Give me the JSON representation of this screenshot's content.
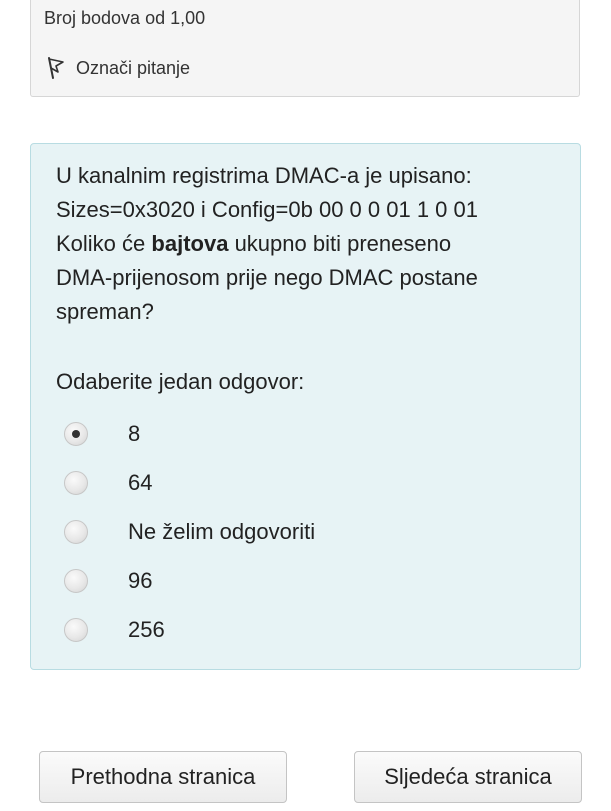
{
  "info": {
    "points_text": "Broj bodova od 1,00",
    "flag_label": "Označi pitanje",
    "flag_icon": "flag-icon"
  },
  "question": {
    "line1": "U kanalnim registrima DMAC-a je upisano:",
    "line2": "Sizes=0x3020 i Config=0b 00 0 0 01 1 0 01",
    "line3_before": "Koliko će",
    "line3_bold": "bajtova",
    "line3_after": "ukupno biti preneseno",
    "line4": "DMA-prijenosom prije nego DMAC postane",
    "line5": "spreman?",
    "prompt": "Odaberite jedan odgovor:",
    "options": [
      {
        "label": "8",
        "selected": true
      },
      {
        "label": "64",
        "selected": false
      },
      {
        "label": "Ne želim odgovoriti",
        "selected": false
      },
      {
        "label": "96",
        "selected": false
      },
      {
        "label": "256",
        "selected": false
      }
    ],
    "colors": {
      "panel_background": "#e7f3f5",
      "panel_border": "#b8dce2"
    }
  },
  "navigation": {
    "prev_label": "Prethodna stranica",
    "next_label": "Sljedeća stranica"
  }
}
